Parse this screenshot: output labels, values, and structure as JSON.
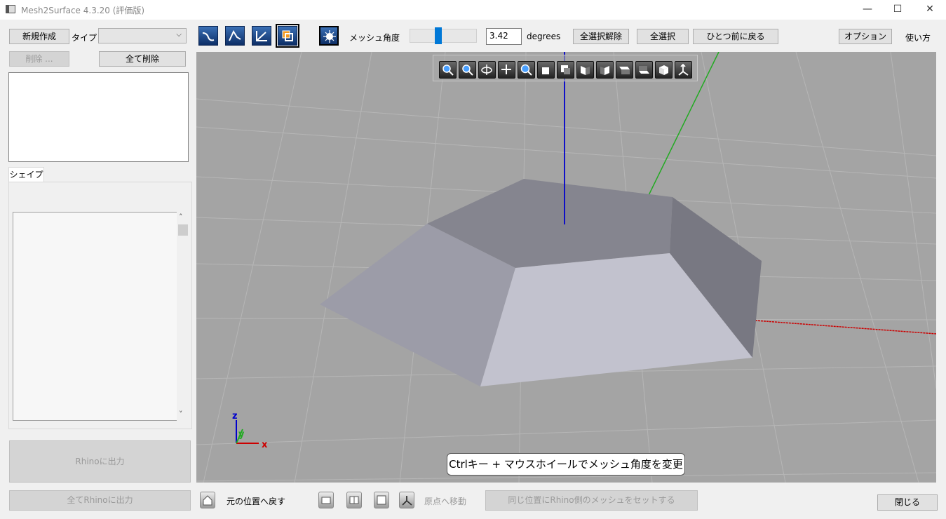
{
  "window": {
    "title": "Mesh2Surface 4.3.20 (評価版)",
    "minimize": "—",
    "maximize": "☐",
    "close": "✕"
  },
  "toolbar": {
    "new_label": "新規作成",
    "type_label": "タイプ",
    "type_value": "",
    "delete_label": "削除 ...",
    "delete_all_label": "全て削除",
    "mesh_angle_label": "メッシュ角度",
    "mesh_angle_value": "3.42",
    "mesh_angle_unit": "degrees",
    "mesh_angle_slider_fraction": 0.42,
    "deselect_all_label": "全選択解除",
    "select_all_label": "全選択",
    "undo_label": "ひとつ前に戻る",
    "options_label": "オプション ...",
    "help_label": "使い方"
  },
  "shape_panel": {
    "tab_label": "シェイプ"
  },
  "left_buttons": {
    "export_rhino": "Rhinoに出力",
    "export_all_rhino": "全てRhinoに出力"
  },
  "viewport": {
    "hint": "Ctrlキー + マウスホイールでメッシュ角度を変更",
    "axis_x": "x",
    "axis_y": "y",
    "axis_z": "z",
    "colors": {
      "x_axis": "#cc0000",
      "y_axis": "#22aa22",
      "z_axis": "#0000cc",
      "background": "#a4a4a4"
    },
    "toolbar_icons": [
      "zoom-extents-icon",
      "zoom-window-icon",
      "rotate-icon",
      "pan-icon",
      "zoom-icon",
      "view-front-icon",
      "view-back-icon",
      "view-left-icon",
      "view-right-icon",
      "view-top-icon",
      "view-bottom-icon",
      "view-iso-icon",
      "view-axes-icon"
    ]
  },
  "bottom_bar": {
    "restore_position_label": "元の位置へ戻す",
    "move_origin_label": "原点へ移動",
    "set_rhino_mesh_label": "同じ位置にRhino側のメッシュをセットする",
    "close_label": "閉じる"
  }
}
